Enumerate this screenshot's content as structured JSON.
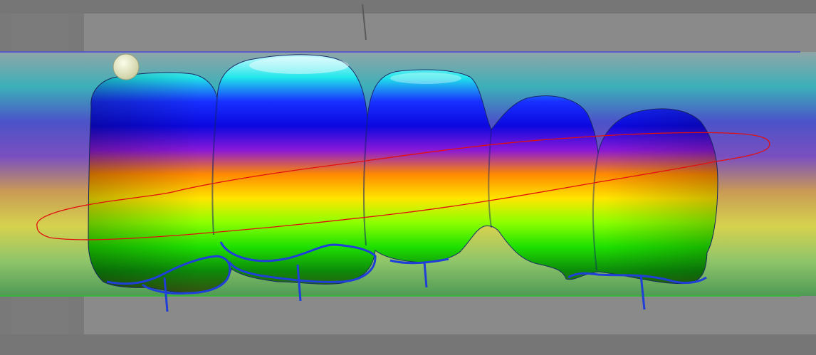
{
  "viewport": {
    "colors": {
      "outer_background": "#767676",
      "panel_gray": "#8a8a8a",
      "top_guide": "#4a4ad6",
      "bottom_guide": "#2ec02e",
      "spline": "#e01010",
      "margin_line": "#1f3fd8",
      "handle": "#e9ebc4",
      "band_stops": [
        "#8fa6a8",
        "#3bb0b8",
        "#4b53c8",
        "#7a4fc0",
        "#c99a55",
        "#d6d24e",
        "#8fc56a",
        "#4f9a55"
      ],
      "tooth_stops": [
        "#d4fbff",
        "#20e6ea",
        "#1830ff",
        "#0b08e0",
        "#8a18d8",
        "#ff8a00",
        "#ffe600",
        "#8cff00",
        "#1ee000",
        "#0c8a0a",
        "#3a4a10"
      ]
    },
    "elements": {
      "bridge": "dental-bridge-mesh",
      "handle": "control-handle",
      "spline": "insertion-spline"
    }
  }
}
